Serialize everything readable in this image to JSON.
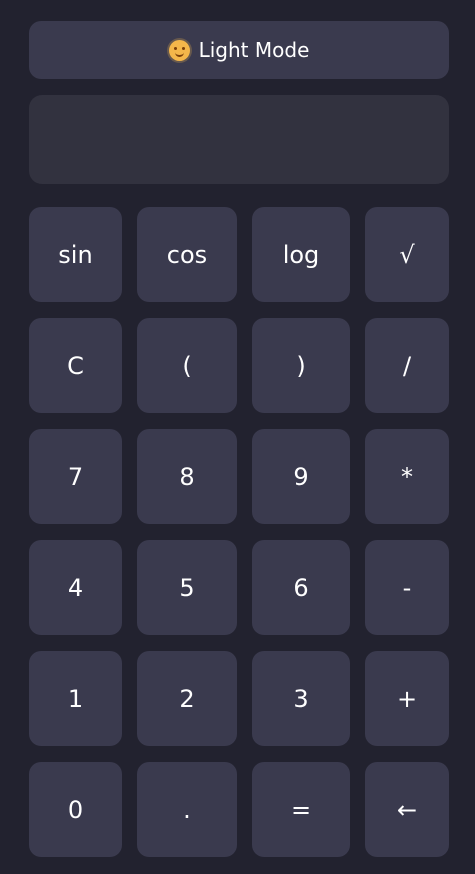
{
  "calculator": {
    "theme_toggle": {
      "icon": "sun-face-icon",
      "label": "Light Mode"
    },
    "display": {
      "value": ""
    },
    "buttons": [
      {
        "name": "sin-button",
        "label": "sin"
      },
      {
        "name": "cos-button",
        "label": "cos"
      },
      {
        "name": "log-button",
        "label": "log"
      },
      {
        "name": "square-root-button",
        "label": "√"
      },
      {
        "name": "clear-button",
        "label": "C"
      },
      {
        "name": "open-parenthesis-button",
        "label": "("
      },
      {
        "name": "close-parenthesis-button",
        "label": ")"
      },
      {
        "name": "divide-button",
        "label": "/"
      },
      {
        "name": "digit-7-button",
        "label": "7"
      },
      {
        "name": "digit-8-button",
        "label": "8"
      },
      {
        "name": "digit-9-button",
        "label": "9"
      },
      {
        "name": "multiply-button",
        "label": "*"
      },
      {
        "name": "digit-4-button",
        "label": "4"
      },
      {
        "name": "digit-5-button",
        "label": "5"
      },
      {
        "name": "digit-6-button",
        "label": "6"
      },
      {
        "name": "subtract-button",
        "label": "-"
      },
      {
        "name": "digit-1-button",
        "label": "1"
      },
      {
        "name": "digit-2-button",
        "label": "2"
      },
      {
        "name": "digit-3-button",
        "label": "3"
      },
      {
        "name": "add-button",
        "label": "+"
      },
      {
        "name": "digit-0-button",
        "label": "0"
      },
      {
        "name": "decimal-point-button",
        "label": "."
      },
      {
        "name": "equals-button",
        "label": "="
      },
      {
        "name": "backspace-button",
        "label": "←"
      }
    ]
  },
  "colors": {
    "background": "#22222f",
    "panel": "#3a3a4e",
    "display": "#32323f",
    "text": "#ffffff",
    "accent_icon": "#f4b64a"
  }
}
